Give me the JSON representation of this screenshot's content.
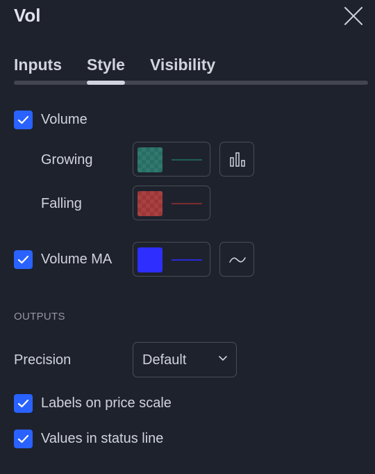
{
  "dialog": {
    "title": "Vol",
    "tabs": [
      {
        "label": "Inputs"
      },
      {
        "label": "Style"
      },
      {
        "label": "Visibility"
      }
    ],
    "active_tab": "Style"
  },
  "style": {
    "volume": {
      "label": "Volume",
      "checked": true,
      "growing": {
        "label": "Growing",
        "color": "#26a69a"
      },
      "falling": {
        "label": "Falling",
        "color": "#ef5350"
      },
      "plot_style_icon": "columns-icon"
    },
    "volume_ma": {
      "label": "Volume MA",
      "checked": true,
      "color": "#2e2eff",
      "plot_style_icon": "line-wave-icon"
    }
  },
  "outputs": {
    "section_label": "OUTPUTS",
    "precision": {
      "label": "Precision",
      "value": "Default"
    },
    "labels_on_price_scale": {
      "label": "Labels on price scale",
      "checked": true
    },
    "values_in_status_line": {
      "label": "Values in status line",
      "checked": true
    }
  },
  "colors": {
    "background": "#1e222d",
    "accent": "#2962ff",
    "text": "#d1d4dc",
    "muted": "#9598a1",
    "border": "#4a4e59"
  }
}
